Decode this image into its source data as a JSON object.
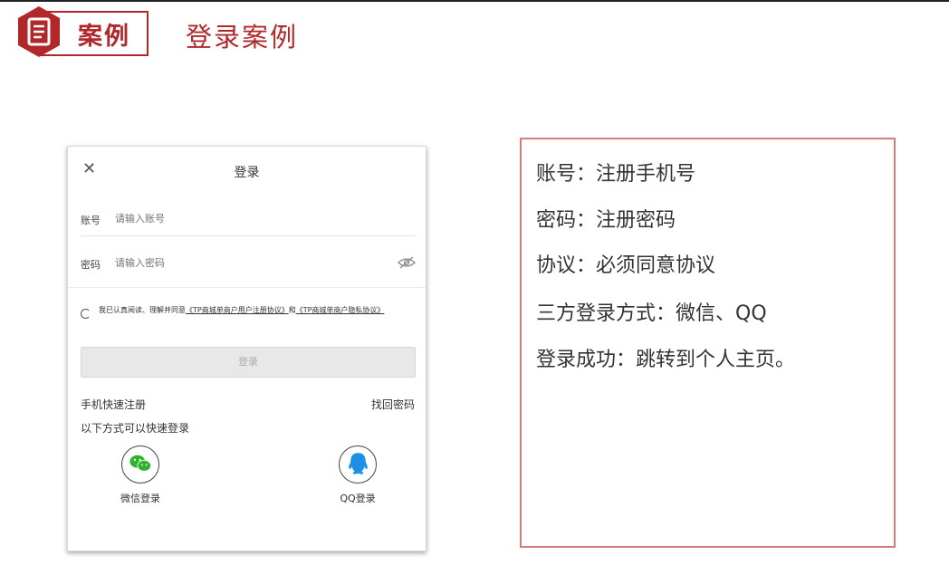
{
  "header": {
    "badge_label": "案例",
    "badge_icon": "document-icon",
    "title": "登录案例",
    "accent_color": "#b1272a"
  },
  "phone": {
    "close_icon": "close-icon",
    "title": "登录",
    "account_label": "账号",
    "account_placeholder": "请输入账号",
    "password_label": "密码",
    "password_placeholder": "请输入密码",
    "agreement_prefix": "我已认真阅读、理解并同意",
    "agreement_link1": "《TP商城单商户用户注册协议》",
    "agreement_and": "和",
    "agreement_link2": "《TP商城单商户隐私协议》",
    "login_button": "登录",
    "register_link": "手机快速注册",
    "forgot_link": "找回密码",
    "quick_login_title": "以下方式可以快速登录",
    "wechat_label": "微信登录",
    "qq_label": "QQ登录"
  },
  "info": {
    "lines": [
      "账号：注册手机号",
      "密码：注册密码",
      "协议：必须同意协议",
      "三方登录方式：微信、QQ",
      "登录成功：跳转到个人主页。"
    ]
  }
}
